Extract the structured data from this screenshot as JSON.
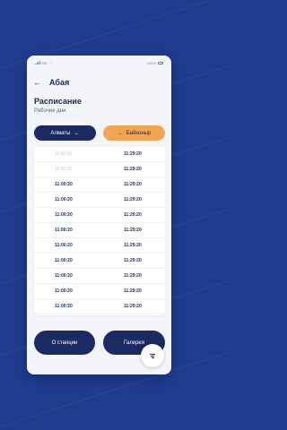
{
  "status_bar": {
    "carrier": "MD",
    "battery": "100%"
  },
  "header": {
    "back_icon": "arrow-left-icon",
    "title": "Абая"
  },
  "section": {
    "title": "Расписание",
    "subtitle": "Рабочие дни"
  },
  "directions": {
    "left": {
      "label": "Алматы",
      "icon": "arrow-left-icon"
    },
    "right": {
      "label": "Байконыр",
      "icon": "arrow-right-icon"
    }
  },
  "schedule": {
    "rows": [
      {
        "from": "11:00:20",
        "to": "11:29:20",
        "dim": true
      },
      {
        "from": "11:00:20",
        "to": "11:29:20",
        "dim": true
      },
      {
        "from": "11:00:20",
        "to": "11:29:20",
        "dim": false
      },
      {
        "from": "11:00:20",
        "to": "11:29:20",
        "dim": false
      },
      {
        "from": "11:00:20",
        "to": "11:29:20",
        "dim": false
      },
      {
        "from": "11:00:20",
        "to": "11:29:20",
        "dim": false
      },
      {
        "from": "11:00:20",
        "to": "11:29:20",
        "dim": false
      },
      {
        "from": "11:00:20",
        "to": "11:29:20",
        "dim": false
      },
      {
        "from": "11:00:20",
        "to": "11:29:20",
        "dim": false
      },
      {
        "from": "11:00:20",
        "to": "11:29:20",
        "dim": false
      },
      {
        "from": "11:00:20",
        "to": "11:29:20",
        "dim": false
      }
    ]
  },
  "buttons": {
    "station": "О станции",
    "gallery": "Галерея"
  },
  "fab": {
    "icon": "filter-icon"
  },
  "colors": {
    "primary": "#1b2a62",
    "accent": "#f2a654",
    "background": "#1f3c8f"
  }
}
